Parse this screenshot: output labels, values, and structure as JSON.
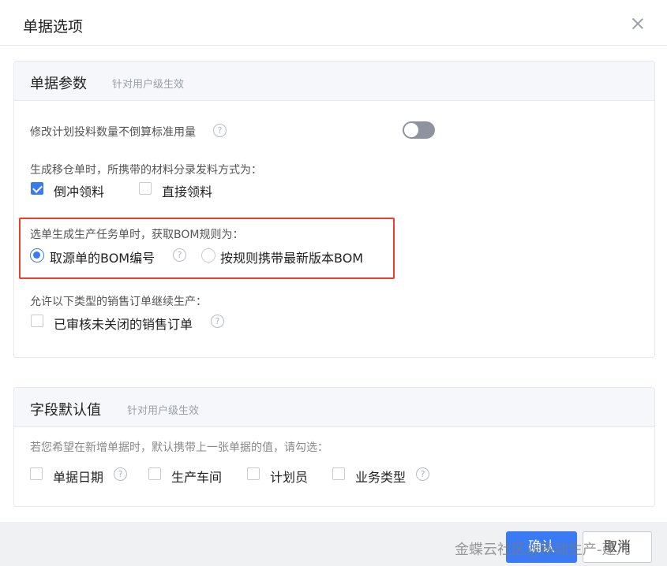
{
  "dialog": {
    "title": "单据选项"
  },
  "params": {
    "title": "单据参数",
    "hint": "针对用户级生效",
    "toggle_label": "修改计划投料数量不倒算标准用量",
    "toggle_on": false,
    "issue_label": "生成移仓单时，所携带的材料分录发料方式为：",
    "issue_options": [
      {
        "label": "倒冲领料",
        "checked": true
      },
      {
        "label": "直接领料",
        "checked": false
      }
    ],
    "bom_label": "选单生成生产任务单时，获取BOM规则为：",
    "bom_options": [
      {
        "label": "取源单的BOM编号",
        "selected": true
      },
      {
        "label": "按规则携带最新版本BOM",
        "selected": false
      }
    ],
    "sales_label": "允许以下类型的销售订单继续生产：",
    "sales_option": {
      "label": "已审核未关闭的销售订单",
      "checked": false
    }
  },
  "defaults": {
    "title": "字段默认值",
    "hint": "针对用户级生效",
    "desc": "若您希望在新增单据时，默认携带上一张单据的值，请勾选：",
    "options": [
      {
        "label": "单据日期",
        "checked": false
      },
      {
        "label": "生产车间",
        "checked": false
      },
      {
        "label": "计划员",
        "checked": false
      },
      {
        "label": "业务类型",
        "checked": false
      }
    ]
  },
  "footer": {
    "ok_label": "确认",
    "cancel_label": "取消"
  },
  "watermark": "金蝶云社区@移动生产-建凡",
  "icons": {
    "help": "?",
    "close": "close-icon"
  },
  "colors": {
    "accent": "#3a7bf5",
    "highlight": "#e8402a"
  }
}
